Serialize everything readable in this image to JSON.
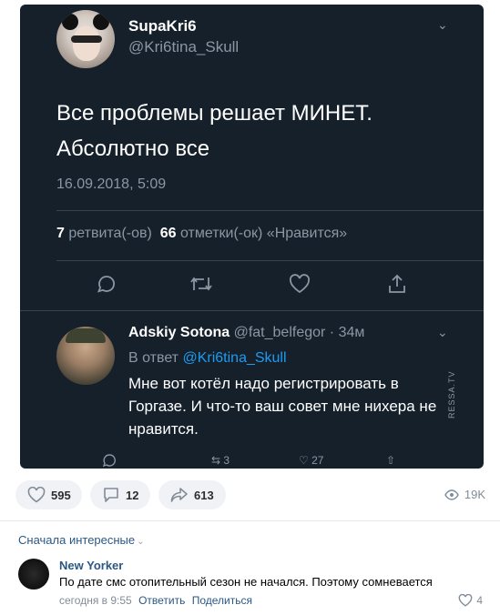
{
  "tweet": {
    "display_name": "SupaKri6",
    "handle": "@Kri6tina_Skull",
    "text": "Все проблемы решает МИНЕТ. Абсолютно все",
    "date": "16.09.2018, 5:09",
    "retweets_count": "7",
    "retweets_label": "ретвита(-ов)",
    "likes_count": "66",
    "likes_label": "отметки(-ок) «Нравится»"
  },
  "reply": {
    "display_name": "Adskiy Sotona",
    "handle": "@fat_belfegor",
    "time": "· 34м",
    "reply_to_prefix": "В ответ",
    "reply_to_handle": "@Kri6tina_Skull",
    "text": "Мне вот котёл надо регистрировать в Горгазе. И что-то ваш совет мне нихера не нравится.",
    "retweets_partial": "3",
    "likes_partial": "27"
  },
  "watermark": "RESSA.TV",
  "post_actions": {
    "likes": "595",
    "comments": "12",
    "shares": "613",
    "views": "19K"
  },
  "comments": {
    "sort_label": "Сначала интересные",
    "items": [
      {
        "author": "New Yorker",
        "text": "По дате смс отопительный сезон не начался. Поэтому сомневается",
        "time": "сегодня в 9:55",
        "reply_label": "Ответить",
        "share_label": "Поделиться",
        "likes": "4"
      }
    ]
  },
  "colors": {
    "tweet_bg": "#15202b",
    "tweet_secondary": "#8a97a3",
    "link_blue": "#2a5885",
    "twitter_blue": "#1d9bf0"
  }
}
